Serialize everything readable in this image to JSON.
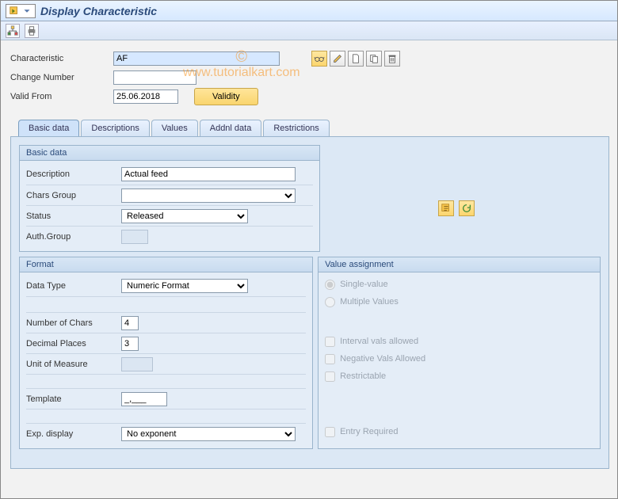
{
  "title": "Display Characteristic",
  "watermark": "www.tutorialkart.com",
  "header_fields": {
    "characteristic_label": "Characteristic",
    "characteristic_value": "AF",
    "change_number_label": "Change Number",
    "change_number_value": "",
    "valid_from_label": "Valid From",
    "valid_from_value": "25.06.2018",
    "validity_btn": "Validity"
  },
  "header_icons": [
    {
      "name": "glasses-icon"
    },
    {
      "name": "pencil-icon"
    },
    {
      "name": "document-icon"
    },
    {
      "name": "copy-icon"
    },
    {
      "name": "trash-icon"
    }
  ],
  "tabs": [
    "Basic data",
    "Descriptions",
    "Values",
    "Addnl data",
    "Restrictions"
  ],
  "basic_data": {
    "box_title": "Basic data",
    "description_label": "Description",
    "description_value": "Actual feed",
    "chars_group_label": "Chars Group",
    "chars_group_value": "",
    "status_label": "Status",
    "status_value": "Released",
    "auth_group_label": "Auth.Group",
    "auth_group_value": ""
  },
  "format": {
    "box_title": "Format",
    "data_type_label": "Data Type",
    "data_type_value": "Numeric Format",
    "num_chars_label": "Number of Chars",
    "num_chars_value": "4",
    "decimal_label": "Decimal Places",
    "decimal_value": "3",
    "uom_label": "Unit of Measure",
    "uom_value": "",
    "template_label": "Template",
    "template_value": "_,___",
    "exp_label": "Exp. display",
    "exp_value": "No exponent"
  },
  "value_assignment": {
    "box_title": "Value assignment",
    "single_value": "Single-value",
    "multiple_values": "Multiple Values",
    "interval": "Interval vals allowed",
    "negative": "Negative Vals Allowed",
    "restrictable": "Restrictable",
    "entry_required": "Entry Required"
  }
}
